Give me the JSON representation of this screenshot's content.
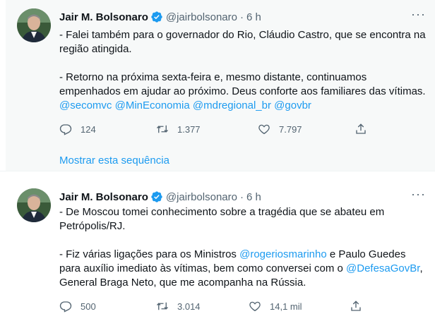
{
  "tweets": [
    {
      "author": {
        "name": "Jair M. Bolsonaro",
        "handle": "@jairbolsonaro",
        "time": "6 h"
      },
      "paragraphs": [
        "- Falei também para o governador do Rio, Cláudio Castro, que se encontra na região atingida.",
        "- Retorno na próxima sexta-feira e, mesmo distante, continuamos empenhados em ajudar ao próximo. Deus conforte aos familiares das vítimas."
      ],
      "mentions": [
        "@secomvc",
        "@MinEconomia",
        "@mdregional_br",
        "@govbr"
      ],
      "stats": {
        "replies": "124",
        "retweets": "1.377",
        "likes": "7.797"
      },
      "thread_link": "Mostrar esta sequência"
    },
    {
      "author": {
        "name": "Jair M. Bolsonaro",
        "handle": "@jairbolsonaro",
        "time": "6 h"
      },
      "p1": "- De Moscou tomei conhecimento sobre a tragédia que se abateu em Petrópolis/RJ.",
      "p2_a": "- Fiz várias ligações para os Ministros ",
      "p2_mention1": "@rogeriosmarinho",
      "p2_b": " e Paulo Guedes para auxílio imediato às vítimas, bem como conversei com o ",
      "p2_mention2": "@DefesaGovBr",
      "p2_c": ", General Braga Neto, que me acompanha na Rússia.",
      "stats": {
        "replies": "500",
        "retweets": "3.014",
        "likes": "14,1 mil"
      }
    }
  ],
  "colors": {
    "accent": "#1d9bf0",
    "secondary_text": "#536471",
    "highlight_bg": "#f7f9f9"
  },
  "icons": [
    "verified-badge-icon",
    "more-icon",
    "reply-icon",
    "retweet-icon",
    "like-icon",
    "share-icon"
  ]
}
